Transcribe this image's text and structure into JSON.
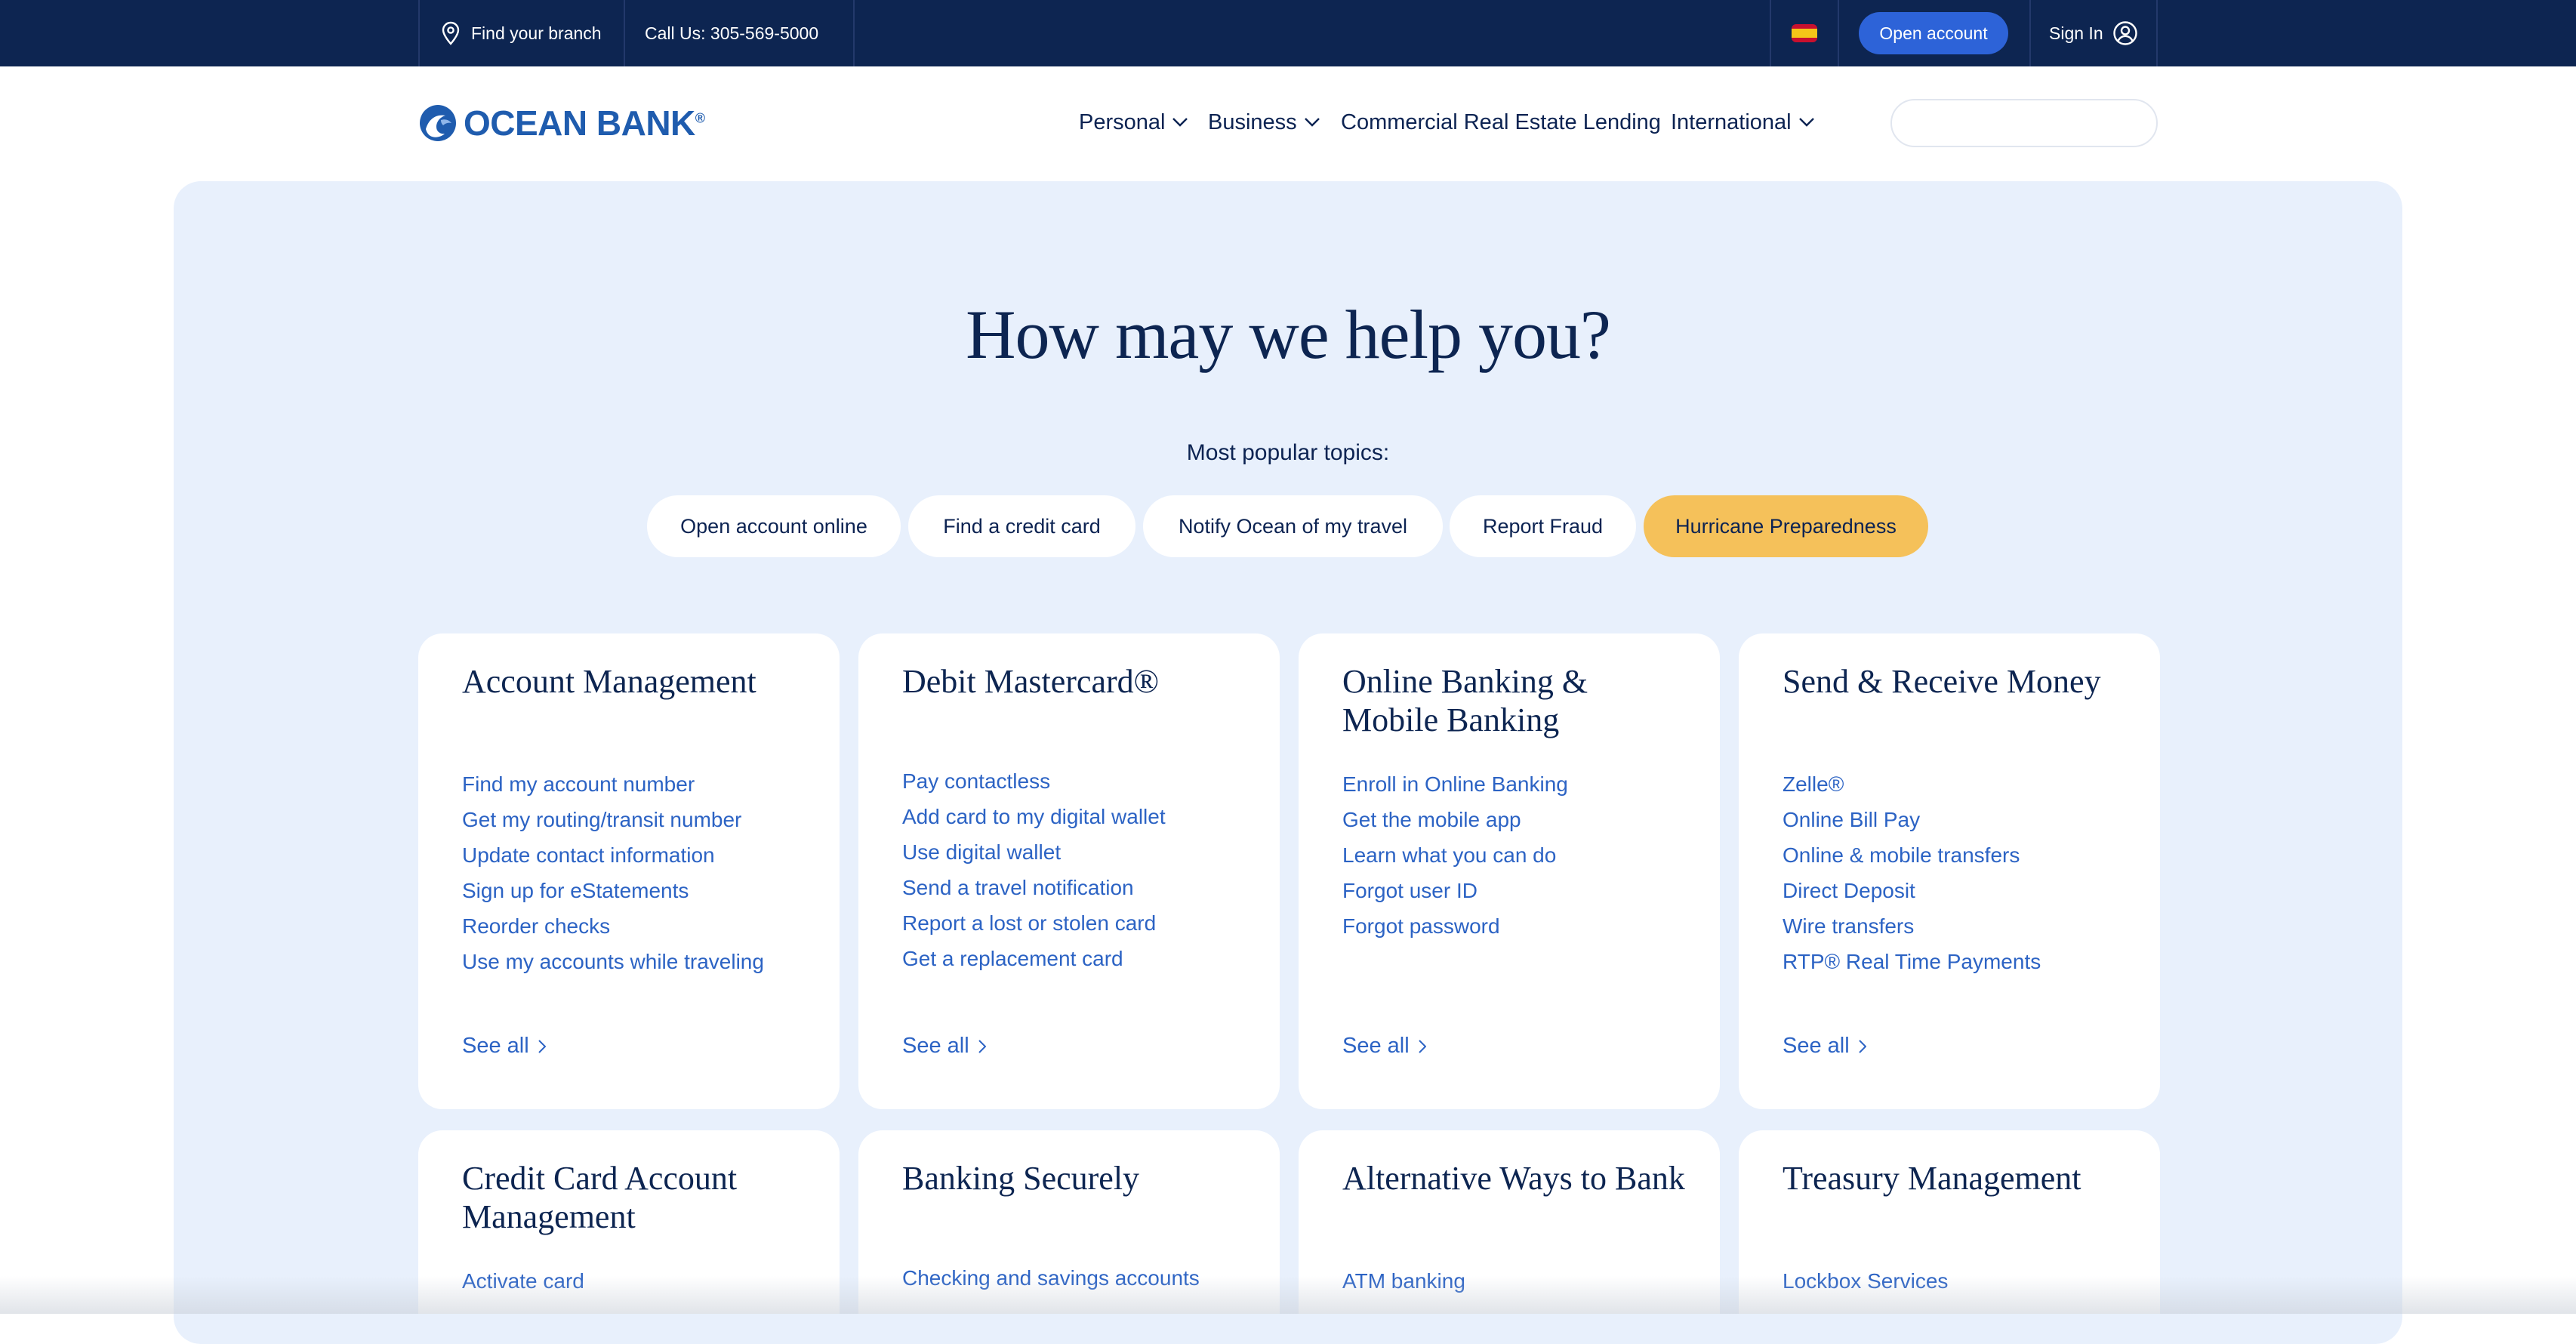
{
  "topbar": {
    "branch_label": "Find your branch",
    "call_label": "Call Us: 305-569-5000",
    "open_account_label": "Open account",
    "sign_in_label": "Sign In"
  },
  "header": {
    "logo_text": "OCEAN BANK",
    "logo_mark": "®",
    "nav": [
      {
        "label": "Personal"
      },
      {
        "label": "Business"
      },
      {
        "label": "Commercial Real Estate Lending"
      },
      {
        "label": "International"
      }
    ],
    "search_placeholder": ""
  },
  "hero": {
    "headline": "How may we help you?",
    "popular_label": "Most popular topics:",
    "pills": [
      {
        "label": "Open account online"
      },
      {
        "label": "Find a credit card"
      },
      {
        "label": "Notify Ocean of my travel"
      },
      {
        "label": "Report Fraud"
      },
      {
        "label": "Hurricane Preparedness"
      }
    ]
  },
  "cards": [
    {
      "title": "Account Management",
      "links": [
        "Find my account number",
        "Get my routing/transit number",
        "Update contact information",
        "Sign up for eStatements",
        "Reorder checks",
        "Use my accounts while traveling"
      ],
      "see_all": "See all"
    },
    {
      "title": "Debit Mastercard®",
      "links": [
        "Pay contactless",
        "Add card to my digital wallet",
        "Use digital wallet",
        "Send a travel notification",
        "Report a lost or stolen card",
        "Get a replacement card"
      ],
      "see_all": "See all"
    },
    {
      "title": "Online Banking & Mobile Banking",
      "links": [
        "Enroll in Online Banking",
        "Get the mobile app",
        "Learn what you can do",
        "Forgot user ID",
        "Forgot password"
      ],
      "see_all": "See all"
    },
    {
      "title": "Send & Receive Money",
      "links": [
        "Zelle®",
        "Online Bill Pay",
        "Online & mobile transfers",
        "Direct Deposit",
        "Wire transfers",
        "RTP® Real Time Payments"
      ],
      "see_all": "See all"
    },
    {
      "title": "Credit Card Account Management",
      "links": [
        "Activate card"
      ]
    },
    {
      "title": "Banking Securely",
      "links": [
        "Checking and savings accounts"
      ]
    },
    {
      "title": "Alternative Ways to Bank",
      "links": [
        "ATM banking"
      ]
    },
    {
      "title": "Treasury Management",
      "links": [
        "Lockbox Services"
      ]
    }
  ],
  "colors": {
    "navy": "#0d2551",
    "accent_blue": "#2d63d8",
    "link_blue": "#2c63c4",
    "panel_bg": "#e8f0fc",
    "highlight_pill": "#f5c15a"
  }
}
